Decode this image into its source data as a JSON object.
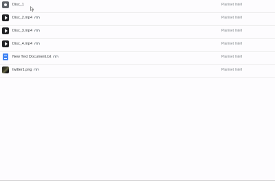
{
  "files": [
    {
      "name": "Disc_1",
      "icon": "folder-icon",
      "shared": false,
      "owner": "Planinet Intell"
    },
    {
      "name": "Disc_2.mp4",
      "icon": "video-icon",
      "shared": true,
      "owner": "Planinet Intell"
    },
    {
      "name": "Disc_3.mp4",
      "icon": "video-icon",
      "shared": true,
      "owner": "Planinet Intell"
    },
    {
      "name": "Disc_4.mp4",
      "icon": "video-icon",
      "shared": true,
      "owner": "Planinet Intell"
    },
    {
      "name": "New Text Document.txt",
      "icon": "doc-icon",
      "shared": true,
      "owner": "Planinet Intell"
    },
    {
      "name": "twitter1.png",
      "icon": "image-icon",
      "shared": true,
      "owner": "Planinet Intell"
    }
  ]
}
